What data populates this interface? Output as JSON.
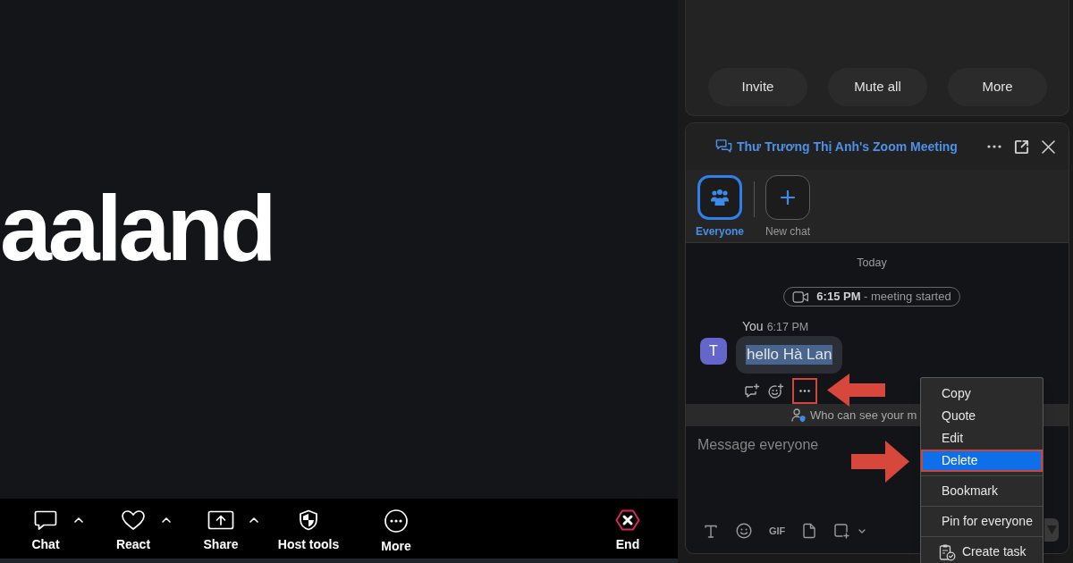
{
  "video": {
    "caption": "aaland"
  },
  "meeting_toolbar": {
    "items": [
      {
        "kind": "chat",
        "label": "Chat",
        "has_menu": true
      },
      {
        "kind": "react",
        "label": "React",
        "has_menu": true
      },
      {
        "kind": "share",
        "label": "Share",
        "has_menu": true
      },
      {
        "kind": "host_tools",
        "label": "Host tools",
        "has_menu": false
      },
      {
        "kind": "more",
        "label": "More",
        "has_menu": false
      },
      {
        "kind": "end",
        "label": "End",
        "has_menu": false
      }
    ]
  },
  "participants_panel": {
    "buttons": [
      "Invite",
      "Mute all",
      "More"
    ]
  },
  "chat_panel": {
    "title": "Thư Trương Thị Anh's Zoom Meeting",
    "recipients": [
      {
        "kind": "group",
        "label": "Everyone",
        "selected": true
      },
      {
        "kind": "new",
        "label": "New chat",
        "selected": false
      }
    ],
    "date_divider": "Today",
    "event": {
      "time": "6:15 PM",
      "text": "- meeting started"
    },
    "messages": [
      {
        "sender": "You",
        "time": "6:17 PM",
        "avatar": "T",
        "text": "hello Hà Lan",
        "text_selected": true,
        "more_button_highlighted": true
      }
    ],
    "privacy_notice": "Who can see your m",
    "composer": {
      "placeholder": "Message everyone",
      "tools": [
        {
          "kind": "format"
        },
        {
          "kind": "emoji"
        },
        {
          "kind": "gif",
          "label": "GIF"
        },
        {
          "kind": "file"
        },
        {
          "kind": "screenshot"
        }
      ]
    }
  },
  "context_menu": {
    "groups": [
      [
        {
          "kind": "text",
          "label": "Copy",
          "selected": false,
          "highlighted": false
        },
        {
          "kind": "text",
          "label": "Quote",
          "selected": false,
          "highlighted": false
        },
        {
          "kind": "text",
          "label": "Edit",
          "selected": false,
          "highlighted": false
        },
        {
          "kind": "text",
          "label": "Delete",
          "selected": true,
          "highlighted": true
        }
      ],
      [
        {
          "kind": "text",
          "label": "Bookmark",
          "selected": false,
          "highlighted": false
        }
      ],
      [
        {
          "kind": "text",
          "label": "Pin for everyone",
          "selected": false,
          "highlighted": false
        }
      ],
      [
        {
          "kind": "task",
          "label": "Create task",
          "selected": false,
          "highlighted": false
        }
      ]
    ]
  }
}
